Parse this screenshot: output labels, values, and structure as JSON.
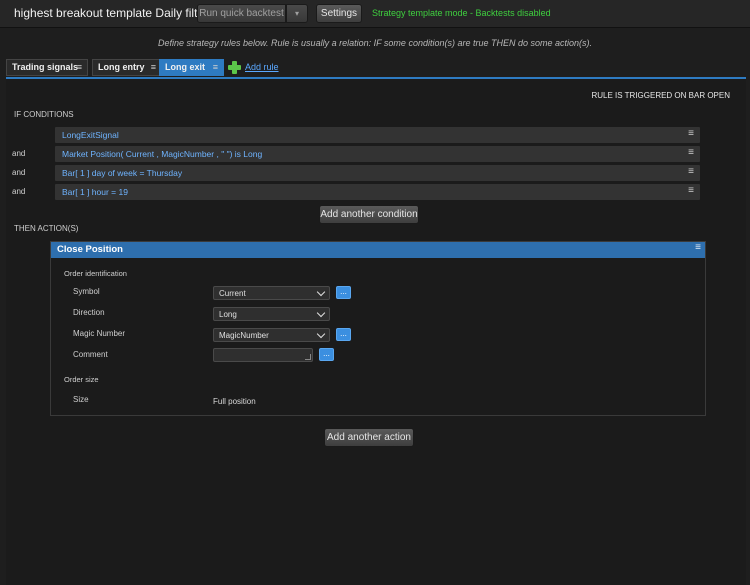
{
  "header": {
    "title": "highest breakout template Daily filter",
    "run_button": "Run quick backtest",
    "run_dropdown": "▾",
    "settings_button": "Settings",
    "mode_status": "Strategy template mode - Backtests disabled"
  },
  "help_text": "Define strategy rules below. Rule is usually a relation: IF some condition(s) are true THEN do some action(s).",
  "tabs": [
    {
      "label": "Trading signals",
      "active": false
    },
    {
      "label": "Long entry",
      "active": false
    },
    {
      "label": "Long exit",
      "active": true
    }
  ],
  "add_rule_label": "Add rule",
  "rule": {
    "trigger_text": "RULE IS TRIGGERED ON BAR OPEN",
    "if_label": "IF CONDITIONS",
    "conditions": [
      {
        "prefix": "",
        "text": "LongExitSignal"
      },
      {
        "prefix": "and",
        "text": "Market Position( Current , MagicNumber , \" \") is Long"
      },
      {
        "prefix": "and",
        "text": "Bar[ 1 ] day of week = Thursday"
      },
      {
        "prefix": "and",
        "text": "Bar[ 1 ] hour = 19"
      }
    ],
    "add_condition_button": "Add another condition",
    "then_label": "THEN ACTION(S)",
    "action": {
      "title": "Close Position",
      "order_identification_label": "Order identification",
      "fields": {
        "symbol": {
          "label": "Symbol",
          "value": "Current"
        },
        "direction": {
          "label": "Direction",
          "value": "Long"
        },
        "magic_number": {
          "label": "Magic Number",
          "value": "MagicNumber"
        },
        "comment": {
          "label": "Comment",
          "value": ""
        }
      },
      "order_size_label": "Order size",
      "size": {
        "label": "Size",
        "value": "Full position"
      },
      "more_button": "..."
    },
    "add_action_button": "Add another action"
  },
  "menu_glyph": "≡",
  "colors": {
    "accent": "#2e7bc2",
    "status_green": "#3fcf3f",
    "condition_text": "#6fb4ff"
  }
}
